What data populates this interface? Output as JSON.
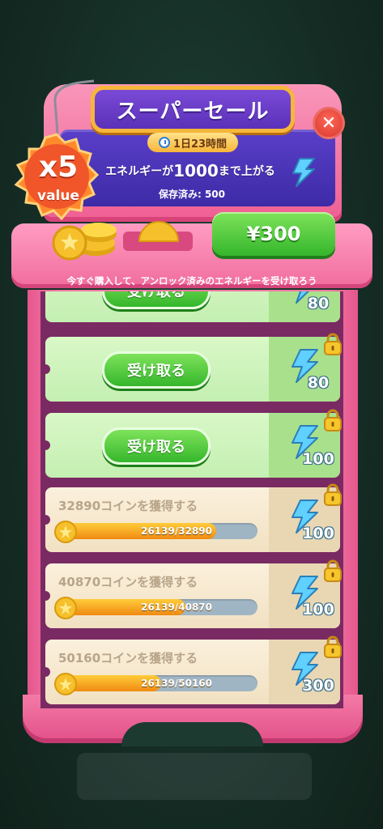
{
  "header": {
    "title": "スーパーセール",
    "timer": "1日23時間",
    "promo_prefix": "エネルギーが",
    "promo_amount": "1000",
    "promo_suffix": "まで上がる",
    "saved": "保存済み: 500",
    "badge_multiplier": "x5",
    "badge_label": "value"
  },
  "purchase": {
    "price": "¥300",
    "hint": "今すぐ購入して、アンロック済みのエネルギーを受け取ろう"
  },
  "rewards": [
    {
      "state": "claimable",
      "button": "受け取る",
      "energy": "80"
    },
    {
      "state": "claimable",
      "button": "受け取る",
      "energy": "80"
    },
    {
      "state": "claimable",
      "button": "受け取る",
      "energy": "100"
    },
    {
      "state": "locked",
      "title": "32890コインを獲得する",
      "progress_text": "26139/32890",
      "progress": 0.795,
      "energy": "100"
    },
    {
      "state": "locked",
      "title": "40870コインを獲得する",
      "progress_text": "26139/40870",
      "progress": 0.64,
      "energy": "100"
    },
    {
      "state": "locked",
      "title": "50160コインを獲得する",
      "progress_text": "26139/50160",
      "progress": 0.52,
      "energy": "300"
    }
  ],
  "icons": {
    "close": "close-icon",
    "clock": "clock-icon",
    "energy": "lightning-bolt-icon",
    "lock": "padlock-icon",
    "coin": "star-coin-icon"
  },
  "colors": {
    "accent_pink": "#f06c9c",
    "screen_purple": "#3d2ba6",
    "button_green": "#35b62c",
    "badge_orange": "#f0562a",
    "energy_blue": "#4ab8f0"
  }
}
